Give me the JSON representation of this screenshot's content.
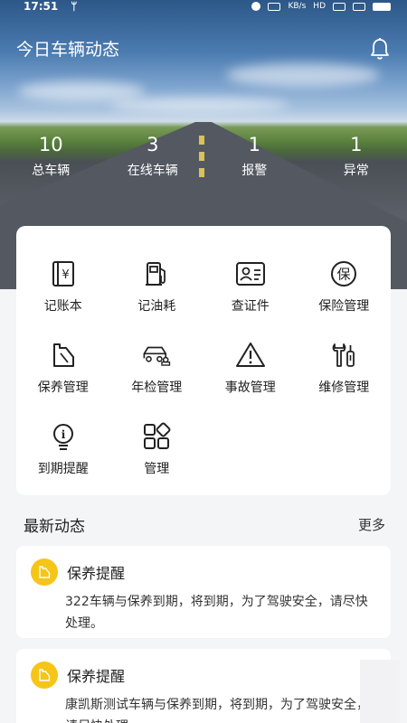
{
  "status_bar": {
    "time": "17:51",
    "signal": "ᛘ",
    "speed": "KB/s",
    "badge": "HD"
  },
  "header": {
    "title": "今日车辆动态"
  },
  "stats": [
    {
      "value": "10",
      "label": "总车辆"
    },
    {
      "value": "3",
      "label": "在线车辆"
    },
    {
      "value": "1",
      "label": "报警"
    },
    {
      "value": "1",
      "label": "异常"
    }
  ],
  "menu": [
    {
      "label": "记账本",
      "icon": "ledger-icon"
    },
    {
      "label": "记油耗",
      "icon": "fuel-icon"
    },
    {
      "label": "查证件",
      "icon": "id-card-icon"
    },
    {
      "label": "保险管理",
      "icon": "insurance-icon"
    },
    {
      "label": "保养管理",
      "icon": "oil-can-icon"
    },
    {
      "label": "年检管理",
      "icon": "car-inspection-icon"
    },
    {
      "label": "事故管理",
      "icon": "warning-icon"
    },
    {
      "label": "维修管理",
      "icon": "wrench-icon"
    },
    {
      "label": "到期提醒",
      "icon": "bulb-icon"
    },
    {
      "label": "管理",
      "icon": "apps-icon"
    }
  ],
  "icon_glyphs": {
    "yen": "¥",
    "bao": "保",
    "info": "i"
  },
  "feed": {
    "title": "最新动态",
    "more": "更多",
    "items": [
      {
        "title": "保养提醒",
        "body": "322车辆与保养到期，将到期，为了驾驶安全，请尽快处理。"
      },
      {
        "title": "保养提醒",
        "body": "康凯斯测试车辆与保养到期，将到期，为了驾驶安全，请尽快处理。"
      }
    ]
  },
  "colors": {
    "accent_yellow": "#f5c518",
    "card_bg": "#ffffff",
    "page_bg": "#f4f5f7"
  }
}
